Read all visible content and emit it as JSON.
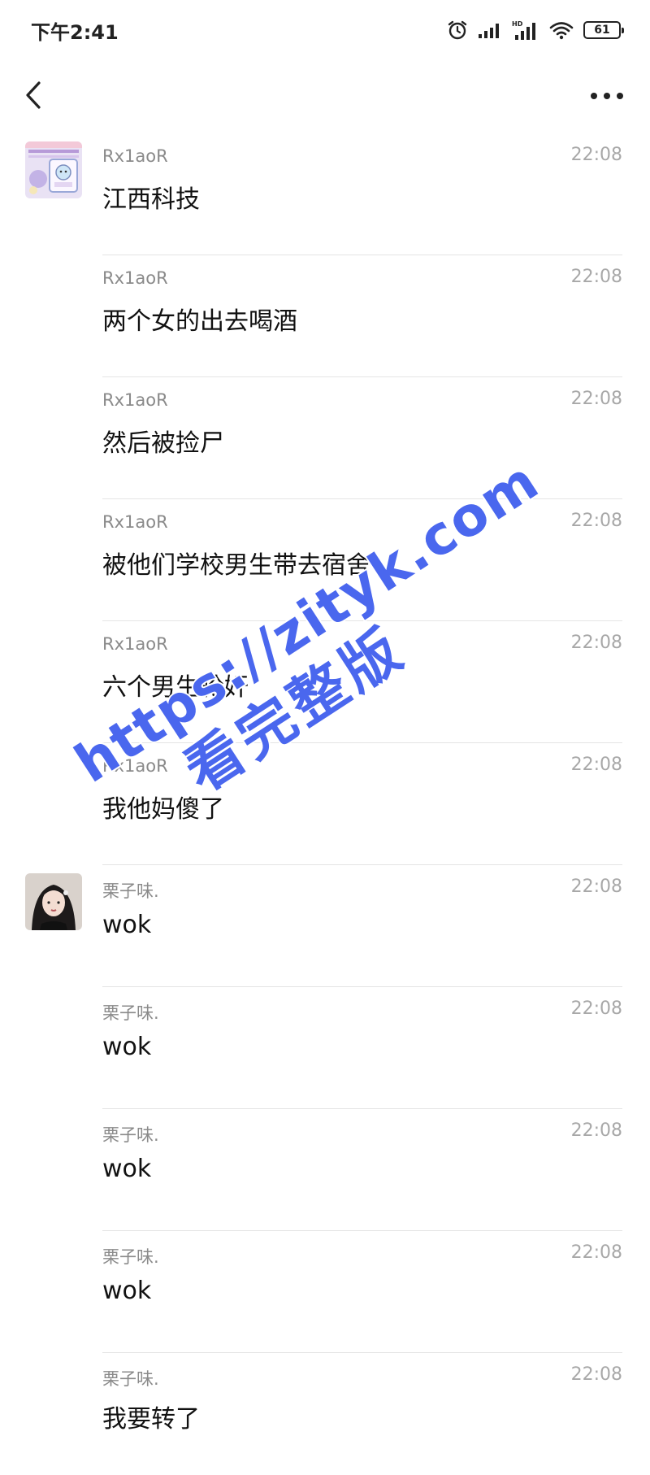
{
  "status_bar": {
    "time": "下午2:41",
    "icons": [
      "alarm-icon",
      "signal-icon",
      "hd-signal-icon",
      "wifi-icon",
      "battery-icon"
    ],
    "battery": "61"
  },
  "nav": {
    "back_icon": "chevron-left-icon",
    "more_icon": "more-dots-icon"
  },
  "messages": [
    {
      "sender": "Rx1aoR",
      "time": "22:08",
      "text": "江西科技",
      "avatar": "cartoon-avatar"
    },
    {
      "sender": "Rx1aoR",
      "time": "22:08",
      "text": "两个女的出去喝酒"
    },
    {
      "sender": "Rx1aoR",
      "time": "22:08",
      "text": "然后被捡尸"
    },
    {
      "sender": "Rx1aoR",
      "time": "22:08",
      "text": "被他们学校男生带去宿舍"
    },
    {
      "sender": "Rx1aoR",
      "time": "22:08",
      "text": "六个男生轮奸"
    },
    {
      "sender": "Rx1aoR",
      "time": "22:08",
      "text": "我他妈傻了"
    },
    {
      "sender": "栗子味.",
      "time": "22:08",
      "text": "wok",
      "avatar": "photo-avatar"
    },
    {
      "sender": "栗子味.",
      "time": "22:08",
      "text": "wok"
    },
    {
      "sender": "栗子味.",
      "time": "22:08",
      "text": "wok"
    },
    {
      "sender": "栗子味.",
      "time": "22:08",
      "text": "wok"
    },
    {
      "sender": "栗子味.",
      "time": "22:08",
      "text": "我要转了"
    }
  ],
  "watermark": {
    "line1": "https://zityk.com",
    "line2": "看完整版"
  },
  "colors": {
    "watermark": "#4a67ee",
    "name": "#8a8a8a",
    "time": "#a8a8a8",
    "divider": "#e4e4e4"
  }
}
